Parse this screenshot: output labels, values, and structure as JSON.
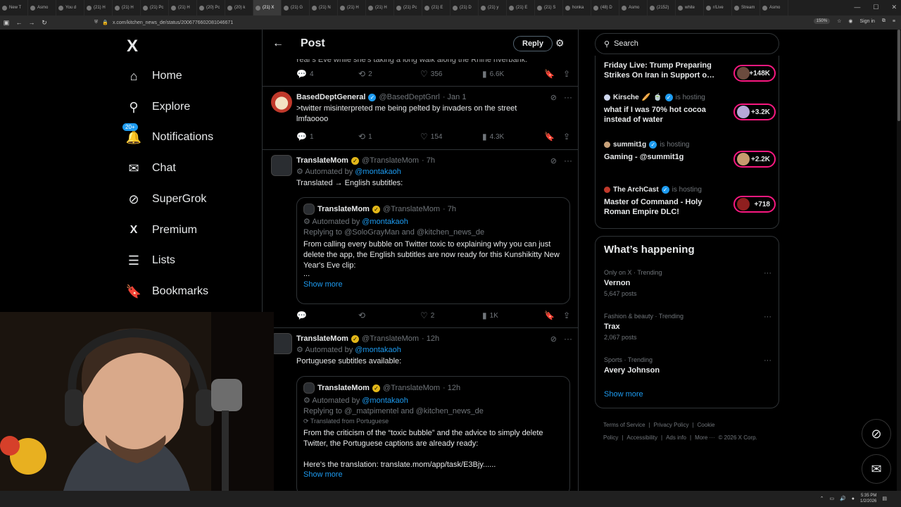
{
  "browser": {
    "tabs": [
      {
        "label": "New T"
      },
      {
        "label": "Asmo"
      },
      {
        "label": "You d"
      },
      {
        "label": "(21) H"
      },
      {
        "label": "(21) H"
      },
      {
        "label": "(21) Pc"
      },
      {
        "label": "(21) H"
      },
      {
        "label": "(20) Pc"
      },
      {
        "label": "(20) k"
      },
      {
        "label": "(21) X",
        "active": true
      },
      {
        "label": "(21) G"
      },
      {
        "label": "(21) N"
      },
      {
        "label": "(21) H"
      },
      {
        "label": "(21) H"
      },
      {
        "label": "(21) Pc"
      },
      {
        "label": "(21) E"
      },
      {
        "label": "(21) D"
      },
      {
        "label": "(21) y"
      },
      {
        "label": "(21) E"
      },
      {
        "label": "(21) S"
      },
      {
        "label": "honka"
      },
      {
        "label": "(48) D"
      },
      {
        "label": "Asmo"
      },
      {
        "label": "(2152)"
      },
      {
        "label": "white"
      },
      {
        "label": "r/Live"
      },
      {
        "label": "Stream"
      },
      {
        "label": "Asmo"
      }
    ],
    "url": "x.com/kitchen_news_de/status/2006776602081046671",
    "zoom": "150%",
    "signin": "Sign in"
  },
  "sidebar": {
    "logo": "X",
    "items": [
      {
        "label": "Home",
        "icon": "⌂"
      },
      {
        "label": "Explore",
        "icon": "⚲"
      },
      {
        "label": "Notifications",
        "icon": "🔔",
        "badge": "20+"
      },
      {
        "label": "Chat",
        "icon": "✉"
      },
      {
        "label": "SuperGrok",
        "icon": "⊘"
      },
      {
        "label": "Premium",
        "icon": "X"
      },
      {
        "label": "Lists",
        "icon": "☰"
      },
      {
        "label": "Bookmarks",
        "icon": "🔖"
      }
    ]
  },
  "main": {
    "title": "Post",
    "reply_button": "Reply",
    "top_fragment": "Year's Eve while she's taking a long walk along the Rhine riverbank.",
    "top_actions": {
      "replies": "4",
      "reposts": "2",
      "likes": "356",
      "views": "6.6K"
    },
    "tweet1": {
      "name": "BasedDeptGeneral",
      "handle": "@BasedDeptGnrl",
      "time": "· Jan 1",
      "text1": ">twitter misinterpreted me being pelted by invaders on the street",
      "text2": "lmfaoooo",
      "replies": "1",
      "reposts": "1",
      "likes": "154",
      "views": "4.3K"
    },
    "tweet2": {
      "name": "TranslateMom",
      "handle": "@TranslateMom",
      "time": "· 7h",
      "automated_prefix": "Automated by",
      "automated_link": "@montakaoh",
      "text": "Translated → English subtitles:",
      "quote": {
        "name": "TranslateMom",
        "handle": "@TranslateMom",
        "time": "· 7h",
        "automated_prefix": "Automated by",
        "automated_link": "@montakaoh",
        "replying": "Replying to @SoloGrayMan and @kitchen_news_de",
        "text": "From calling every bubble on Twitter toxic to explaining why you can just delete the app, the English subtitles are now ready for this Kunshikitty New Year's Eve clip:",
        "ellipsis": "...",
        "show_more": "Show more"
      },
      "replies": "",
      "reposts": "",
      "likes": "2",
      "views": "1K"
    },
    "tweet3": {
      "name": "TranslateMom",
      "handle": "@TranslateMom",
      "time": "· 12h",
      "automated_prefix": "Automated by",
      "automated_link": "@montakaoh",
      "text": "Portuguese subtitles available:",
      "quote": {
        "name": "TranslateMom",
        "handle": "@TranslateMom",
        "time": "· 12h",
        "automated_prefix": "Automated by",
        "automated_link": "@montakaoh",
        "replying": "Replying to @_matpimentel and @kitchen_news_de",
        "translated": "Translated from Portuguese",
        "text": "From the criticism of the “toxic bubble” and the advice to simply delete Twitter, the Portuguese captions are already ready:",
        "text2": "Here's the translation: translate.mom/app/task/E3Bjy......",
        "show_more": "Show more"
      }
    }
  },
  "right": {
    "search_placeholder": "Search",
    "lives": [
      {
        "host": "",
        "title": "Friday Live: Trump Preparing Strikes On Iran in Support o…",
        "count": "+148K"
      },
      {
        "host": "Kirsche",
        "hosting": "is hosting",
        "title": "what if I was 70% hot cocoa instead of water",
        "count": "+3.2K"
      },
      {
        "host": "summit1g",
        "hosting": "is hosting",
        "title": "Gaming - @summit1g",
        "count": "+2.2K"
      },
      {
        "host": "The ArchCast",
        "hosting": "is hosting",
        "title": "Master of Command - Holy Roman Empire DLC!",
        "count": "+718"
      }
    ],
    "whats_happening": "What’s happening",
    "trends": [
      {
        "context": "Only on X · Trending",
        "name": "Vernon",
        "count": "5,647 posts"
      },
      {
        "context": "Fashion & beauty · Trending",
        "name": "Trax",
        "count": "2,067 posts"
      },
      {
        "context": "Sports · Trending",
        "name": "Avery Johnson",
        "count": ""
      }
    ],
    "show_more": "Show more",
    "footer": [
      "Terms of Service",
      "|",
      "Privacy Policy",
      "|",
      "Cookie Policy",
      "|",
      "Accessibility",
      "|",
      "Ads info",
      "|",
      "More ···",
      "© 2026 X Corp."
    ]
  },
  "taskbar": {
    "time": "5:35 PM",
    "date": "1/2/2026"
  },
  "colors": {
    "accent": "#1d9bf0",
    "live": "#f91880",
    "verified_gold": "#e2b719"
  }
}
